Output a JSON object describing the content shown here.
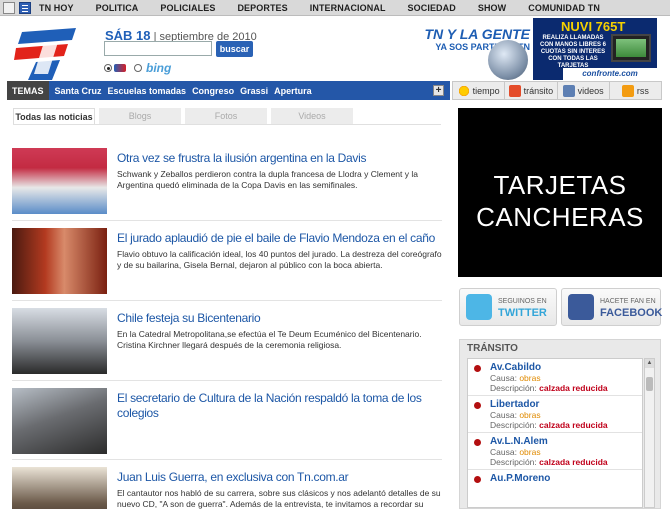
{
  "topnav": {
    "items": [
      "TN HOY",
      "POLITICA",
      "POLICIALES",
      "DEPORTES",
      "INTERNACIONAL",
      "SOCIEDAD",
      "SHOW",
      "COMUNIDAD TN"
    ]
  },
  "header": {
    "day": "SÁB 18",
    "date_rest": " | septiembre de 2010",
    "search_button": "buscar",
    "bing_label": "bing",
    "tn_gente_line1": "TN Y LA GENTE",
    "tn_gente_line2": "YA SOS PARTE DE TN"
  },
  "ad": {
    "title": "NUVI 765T",
    "text": "REALIZA LLAMADAS CON MANOS LIBRES 6 CUOTAS SIN INTERES CON TODAS LAS TARJETAS",
    "brand": "confronte.com"
  },
  "temas": {
    "label": "TEMAS",
    "topics": [
      "Santa Cruz",
      "Escuelas tomadas",
      "Congreso",
      "Grassi",
      "Apertura"
    ],
    "plus": "+"
  },
  "tools": [
    "tiempo",
    "tránsito",
    "videos",
    "rss"
  ],
  "tabs": [
    "Todas las noticias",
    "Blogs",
    "Fotos",
    "Videos"
  ],
  "news": [
    {
      "headline": "Otra vez se frustra la ilusión argentina en la Davis",
      "desc": "Schwank y Zeballos perdieron contra la dupla francesa de Llodra y Clement y la Argentina quedó eliminada de la Copa Davis en las semifinales."
    },
    {
      "headline": "El jurado aplaudió de pie el baile de Flavio Mendoza en el caño",
      "desc": "Flavio obtuvo la calificación ideal, los 40 puntos del jurado. La destreza del coreógrafo y de su bailarina, Gisela Bernal, dejaron al público con la boca abierta."
    },
    {
      "headline": "Chile festeja su Bicentenario",
      "desc": "En la Catedral Metropolitana,se efectúa el Te Deum Ecuménico del Bicentenario. Cristina Kirchner llegará después de la ceremonia religiosa."
    },
    {
      "headline": "El secretario de Cultura de la Nación respaldó la toma de los colegios",
      "desc": ""
    },
    {
      "headline": "Juan Luis Guerra, en exclusiva con Tn.com.ar",
      "desc": "El cantautor nos habló de su carrera, sobre sus clásicos y nos adelantó detalles de su nuevo CD, \"A son de guerra\". Además de la entrevista, te invitamos a recordar su tema"
    }
  ],
  "promo": {
    "line1": "TARJETAS",
    "line2": "CANCHERAS"
  },
  "social": {
    "twitter_small": "SEGUINOS EN",
    "twitter_big": "TWITTER",
    "facebook_small": "HACETE FAN EN",
    "facebook_big": "FACEBOOK"
  },
  "transito": {
    "title": "TRÁNSITO",
    "cause_label": "Causa:",
    "desc_label": "Descripción:",
    "items": [
      {
        "name": "Av.Cabildo",
        "cause": "obras",
        "desc": "calzada reducida"
      },
      {
        "name": "Libertador",
        "cause": "obras",
        "desc": "calzada reducida"
      },
      {
        "name": "Av.L.N.Alem",
        "cause": "obras",
        "desc": "calzada reducida"
      },
      {
        "name": "Au.P.Moreno",
        "cause": "",
        "desc": ""
      }
    ]
  }
}
